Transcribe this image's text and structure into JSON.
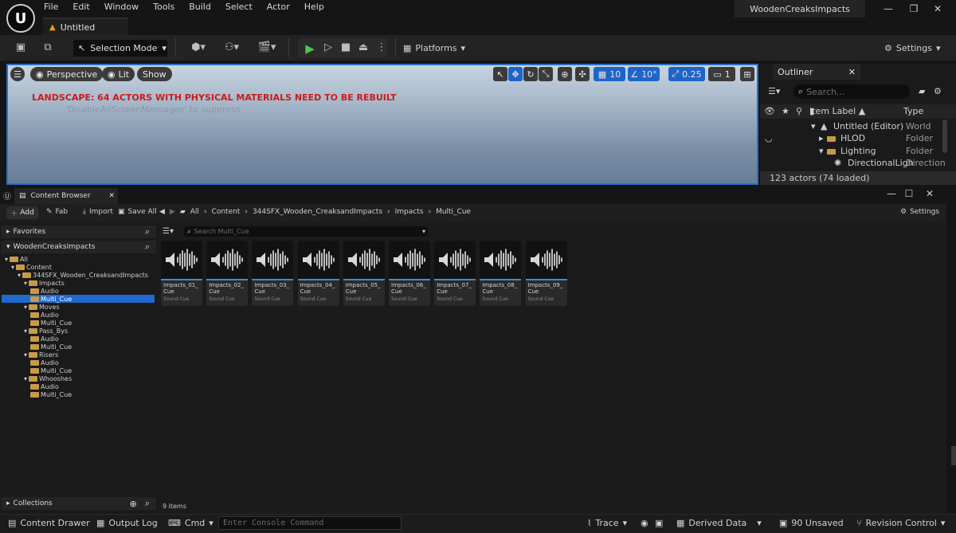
{
  "menu": [
    "File",
    "Edit",
    "Window",
    "Tools",
    "Build",
    "Select",
    "Actor",
    "Help"
  ],
  "level_tab": {
    "label": "Untitled"
  },
  "project_title": "WoodenCreaksImpacts",
  "toolbar": {
    "selection_mode": "Selection Mode",
    "platforms": "Platforms",
    "settings": "Settings"
  },
  "viewport": {
    "perspective": "Perspective",
    "lit": "Lit",
    "show": "Show",
    "grid_snap": "10",
    "rot_snap": "10°",
    "scale_snap": "0.25",
    "camera_speed": "1",
    "landscape_msg": "LANDSCAPE: 64 ACTORS WITH PHYSICAL MATERIALS NEED TO BE REBUILT",
    "suppress_msg": "'DisableAllScreenMessages' to suppress"
  },
  "outliner": {
    "tab": "Outliner",
    "search_placeholder": "Search...",
    "col_label": "Item Label ▲",
    "col_type": "Type",
    "rows": [
      {
        "label": "Untitled (Editor)",
        "type": "World"
      },
      {
        "label": "HLOD",
        "type": "Folder"
      },
      {
        "label": "Lighting",
        "type": "Folder"
      },
      {
        "label": "DirectionalLigh",
        "type": "Direction"
      }
    ],
    "actor_count": "123 actors (74 loaded)"
  },
  "content_browser": {
    "tab": "Content Browser",
    "add": "Add",
    "fab": "Fab",
    "import": "Import",
    "save_all": "Save All",
    "breadcrumb": [
      "All",
      "Content",
      "344SFX_Wooden_CreaksandImpacts",
      "Impacts",
      "Multi_Cue"
    ],
    "settings": "Settings",
    "favorites": "Favorites",
    "project": "WoodenCreaksImpacts",
    "collections": "Collections",
    "search_placeholder": "Search Multi_Cue",
    "tree": [
      {
        "label": "All"
      },
      {
        "label": "Content"
      },
      {
        "label": "344SFX_Wooden_CreaksandImpacts"
      },
      {
        "label": "Impacts"
      },
      {
        "label": "Audio"
      },
      {
        "label": "Multi_Cue"
      },
      {
        "label": "Moves"
      },
      {
        "label": "Audio"
      },
      {
        "label": "Multi_Cue"
      },
      {
        "label": "Pass_Bys"
      },
      {
        "label": "Audio"
      },
      {
        "label": "Multi_Cue"
      },
      {
        "label": "Risers"
      },
      {
        "label": "Audio"
      },
      {
        "label": "Multi_Cue"
      },
      {
        "label": "Whooshes"
      },
      {
        "label": "Audio"
      },
      {
        "label": "Multi_Cue"
      }
    ],
    "assets": [
      {
        "name": "Impacts_01_ Cue",
        "type": "Sound Cue"
      },
      {
        "name": "Impacts_02_ Cue",
        "type": "Sound Cue"
      },
      {
        "name": "Impacts_03_ Cue",
        "type": "Sound Cue"
      },
      {
        "name": "Impacts_04_ Cue",
        "type": "Sound Cue"
      },
      {
        "name": "Impacts_05_ Cue",
        "type": "Sound Cue"
      },
      {
        "name": "Impacts_06_ Cue",
        "type": "Sound Cue"
      },
      {
        "name": "Impacts_07_ Cue",
        "type": "Sound Cue"
      },
      {
        "name": "Impacts_08_ Cue",
        "type": "Sound Cue"
      },
      {
        "name": "Impacts_09_ Cue",
        "type": "Sound Cue"
      }
    ],
    "item_count": "9 items"
  },
  "statusbar": {
    "content_drawer": "Content Drawer",
    "output_log": "Output Log",
    "cmd": "Cmd",
    "console_placeholder": "Enter Console Command",
    "trace": "Trace",
    "derived_data": "Derived Data",
    "unsaved": "90 Unsaved",
    "revision": "Revision Control"
  }
}
